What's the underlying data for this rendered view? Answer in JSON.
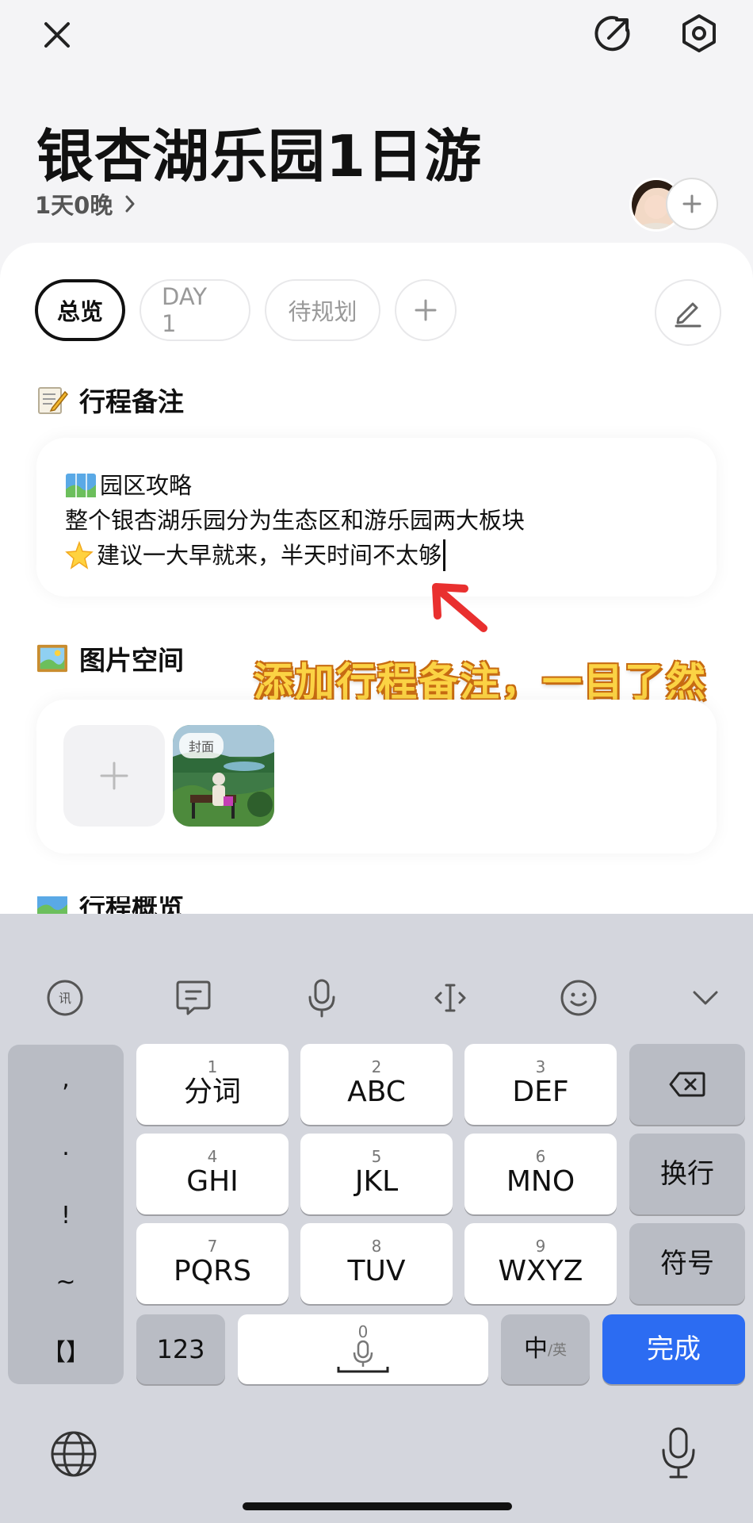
{
  "header": {
    "title": "银杏湖乐园1日游",
    "duration": "1天0晚"
  },
  "tabs": [
    {
      "label": "总览",
      "active": true
    },
    {
      "label": "DAY 1",
      "active": false
    },
    {
      "label": "待规划",
      "active": false
    }
  ],
  "notes_section": {
    "title": "行程备注",
    "lines": [
      "园区攻略",
      "整个银杏湖乐园分为生态区和游乐园两大板块",
      "建议一大早就来，半天时间不太够"
    ]
  },
  "overlay_caption": "添加行程备注，一目了然",
  "photos_section": {
    "title": "图片空间",
    "cover_badge": "封面"
  },
  "overview_section": {
    "title": "行程概览"
  },
  "keyboard": {
    "punctuation": [
      ",",
      ".",
      "!",
      "~",
      "【】"
    ],
    "keys": [
      {
        "num": "1",
        "label": "分词"
      },
      {
        "num": "2",
        "label": "ABC"
      },
      {
        "num": "3",
        "label": "DEF"
      },
      {
        "num": "4",
        "label": "GHI"
      },
      {
        "num": "5",
        "label": "JKL"
      },
      {
        "num": "6",
        "label": "MNO"
      },
      {
        "num": "7",
        "label": "PQRS"
      },
      {
        "num": "8",
        "label": "TUV"
      },
      {
        "num": "9",
        "label": "WXYZ"
      }
    ],
    "enter_label": "换行",
    "symbols_label": "符号",
    "numbers_label": "123",
    "space_num": "0",
    "lang_main": "中",
    "lang_sub": "/英",
    "done_label": "完成"
  },
  "colors": {
    "accent": "#2c6cf2",
    "caption_fill": "#fbd344",
    "caption_outline": "#c76b12"
  }
}
